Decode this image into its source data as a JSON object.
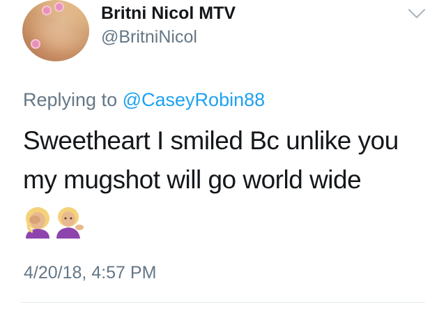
{
  "author": {
    "display_name": "Britni Nicol MTV",
    "handle": "@BritniNicol"
  },
  "reply": {
    "prefix": "Replying to",
    "mention": "@CaseyRobin88"
  },
  "tweet": {
    "text": "Sweetheart I smiled Bc unlike you my mugshot will go world wide",
    "emojis": [
      "woman-facepalming-emoji",
      "woman-tipping-hand-emoji"
    ],
    "timestamp": "4/20/18, 4:57 PM"
  },
  "icons": {
    "more": "chevron-down-icon"
  },
  "colors": {
    "primary_text": "#14171a",
    "secondary_text": "#657786",
    "link": "#1da1f2",
    "divider": "#e1e8ed"
  }
}
